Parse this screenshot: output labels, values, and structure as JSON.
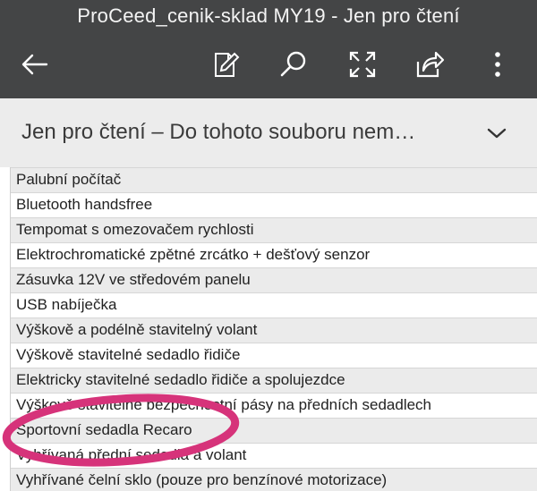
{
  "app": {
    "title": "ProCeed_cenik-sklad MY19 - Jen pro čtení",
    "toolbar": {
      "back_icon": "back-arrow-icon",
      "edit_icon": "edit-pencil-icon",
      "search_icon": "search-icon",
      "fullscreen_icon": "fullscreen-icon",
      "share_icon": "share-icon",
      "more_icon": "more-vertical-icon"
    }
  },
  "banner": {
    "text": "Jen pro čtení – Do tohoto souboru nem…",
    "chevron_icon": "chevron-down-icon"
  },
  "sheet": {
    "rows": [
      {
        "text": "Palubní počítač",
        "shaded": true
      },
      {
        "text": "Bluetooth handsfree",
        "shaded": false
      },
      {
        "text": "Tempomat s omezovačem rychlosti",
        "shaded": true
      },
      {
        "text": "Elektrochromatické zpětné zrcátko + dešťový senzor",
        "shaded": false
      },
      {
        "text": "Zásuvka 12V ve středovém panelu",
        "shaded": true
      },
      {
        "text": "USB nabíječka",
        "shaded": false
      },
      {
        "text": "Výškově a podélně stavitelný volant",
        "shaded": true
      },
      {
        "text": "Výškově stavitelné sedadlo řidiče",
        "shaded": false
      },
      {
        "text": "Elektricky stavitelné sedadlo řidiče a spolujezdce",
        "shaded": true
      },
      {
        "text": "Výškově stavitelné bezpečnostní pásy na předních sedadlech",
        "shaded": false
      },
      {
        "text": "Sportovní sedadla Recaro",
        "shaded": true
      },
      {
        "text": "Vyhřívaná přední sedadla a volant",
        "shaded": false
      },
      {
        "text": "Vyhřívané čelní sklo (pouze pro benzínové motorizace)",
        "shaded": true
      }
    ]
  },
  "annotation": {
    "color": "#d6337a",
    "target": "Sportovní sedadla Recaro"
  },
  "colors": {
    "appbar": "#444546",
    "banner": "#ececec",
    "row_shaded": "#ebebeb"
  }
}
